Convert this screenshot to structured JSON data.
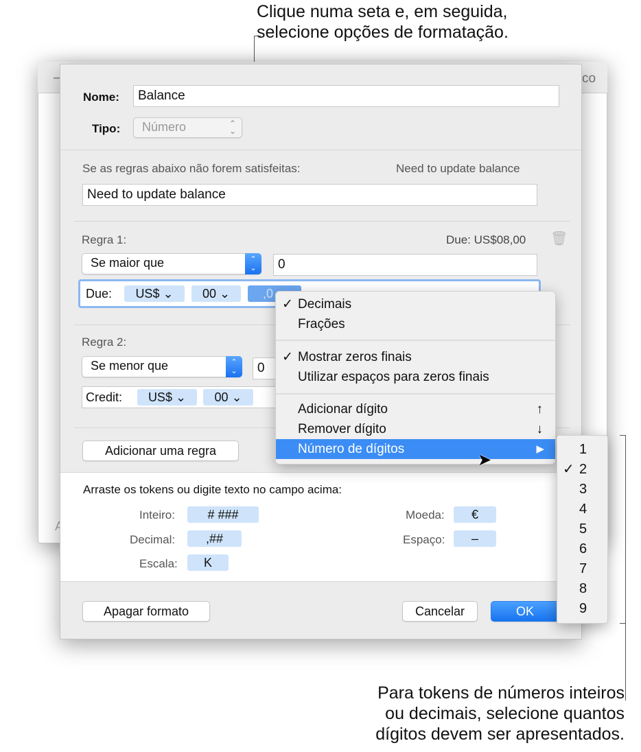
{
  "callouts": {
    "top": [
      "Clique numa seta e, em seguida,",
      "selecione opções de formatação."
    ],
    "bottom": [
      "Para tokens de números inteiros",
      "ou decimais, selecione quantos",
      "dígitos devem ser apresentados."
    ]
  },
  "background_window": {
    "partial_right_text": "co",
    "partial_left_text": "A"
  },
  "dialog": {
    "name_label": "Nome:",
    "name_value": "Balance",
    "type_label": "Tipo:",
    "type_value": "Número",
    "unmet_label": "Se as regras abaixo não forem satisfeitas:",
    "unmet_preview": "Need to update balance",
    "unmet_value": "Need to update balance",
    "rules": [
      {
        "label": "Regra 1:",
        "preview": "Due: US$08,00",
        "condition": "Se maior que",
        "value": "0",
        "format_prefix": "Due:",
        "tokens": [
          "US$",
          "00",
          ",0"
        ]
      },
      {
        "label": "Regra 2:",
        "condition": "Se menor que",
        "value": "0",
        "format_prefix": "Credit:",
        "tokens": [
          "US$",
          "00"
        ]
      }
    ],
    "add_rule_button": "Adicionar uma regra",
    "tokens_hint": "Arraste os tokens ou digite texto no campo acima:",
    "token_palette": {
      "integer": {
        "label": "Inteiro:",
        "token": "# ###"
      },
      "decimal": {
        "label": "Decimal:",
        "token": ",##"
      },
      "scale": {
        "label": "Escala:",
        "token": "K"
      },
      "currency": {
        "label": "Moeda:",
        "token": "€"
      },
      "space": {
        "label": "Espaço:",
        "token": "–"
      }
    },
    "clear_button": "Apagar formato",
    "cancel_button": "Cancelar",
    "ok_button": "OK"
  },
  "menu": {
    "items": [
      {
        "label": "Decimais",
        "checked": true
      },
      {
        "label": "Frações",
        "checked": false
      },
      {
        "label": "Mostrar zeros finais",
        "checked": true
      },
      {
        "label": "Utilizar espaços para zeros finais",
        "checked": false
      },
      {
        "label": "Adicionar dígito",
        "shortcut": "↑"
      },
      {
        "label": "Remover dígito",
        "shortcut": "↓"
      },
      {
        "label": "Número de dígitos",
        "submenu_arrow": "▶",
        "highlighted": true
      }
    ],
    "check_glyph": "✓"
  },
  "submenu": {
    "items": [
      "1",
      "2",
      "3",
      "4",
      "5",
      "6",
      "7",
      "8",
      "9"
    ],
    "selected": "2"
  },
  "colors": {
    "accent": "#3b8df5",
    "token": "#cfe4fb"
  }
}
